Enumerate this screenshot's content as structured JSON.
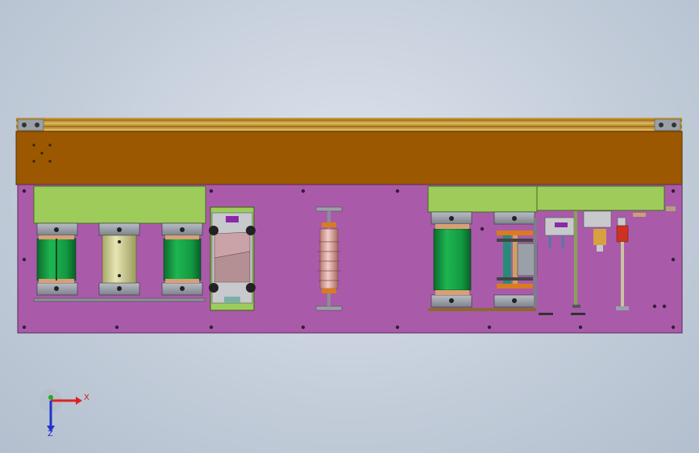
{
  "viewport": {
    "background": "#c8d1dd",
    "colors": {
      "top_rail": "#b98a2a",
      "top_beam": "#9b5a00",
      "main_plate": "#a85aa8",
      "green_housing": "#9dcc5a",
      "green_cylinder": "#17a34a",
      "olive_cylinder": "#d8d8a0",
      "gray_block": "#9aa0a8",
      "orange": "#d97b1f",
      "pink_insulator": "#e6b7b0"
    }
  },
  "triad": {
    "x_label": "X",
    "z_label": "Z",
    "x_axis_color": "#dd2222",
    "y_axis_color": "#22aa22",
    "z_axis_color": "#2233cc"
  }
}
